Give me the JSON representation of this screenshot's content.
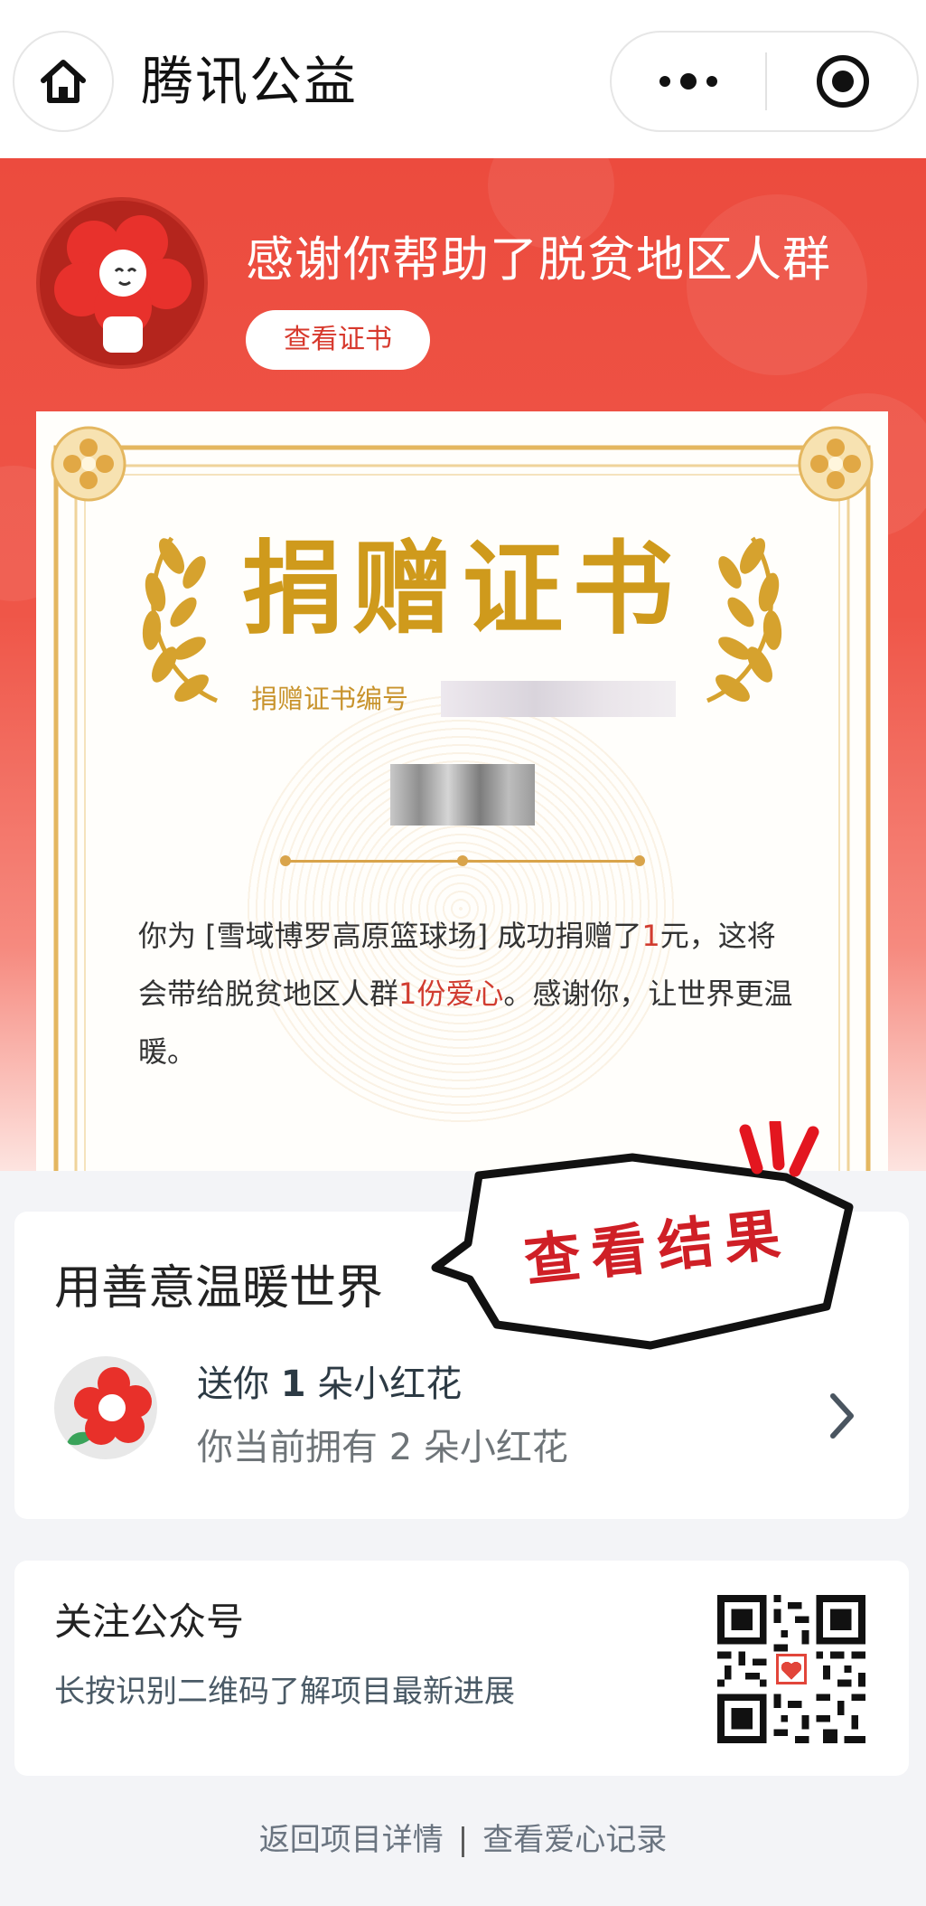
{
  "nav": {
    "title": "腾讯公益",
    "home_icon": "home-icon",
    "more_icon": "more-dots-icon",
    "close_icon": "target-close-icon"
  },
  "banner": {
    "title": "感谢你帮助了脱贫地区人群",
    "cert_button": "查看证书",
    "accent_color": "#ec4b3e"
  },
  "certificate": {
    "title": "捐赠证书",
    "number_label": "捐赠证书编号",
    "text_before": "你为 [雪域博罗高原篮球场] 成功捐赠了",
    "amount": "1",
    "text_mid1": "元，这将会带给脱贫地区人群",
    "love_count": "1份爱心",
    "text_end": "。感谢你，让世界更温暖。",
    "gold_color": "#cf9a1c"
  },
  "sticker": {
    "label": "查看结果"
  },
  "kindness_card": {
    "title": "用善意温暖世界",
    "gift_prefix": "送你",
    "gift_count": "1",
    "gift_suffix": "朵小红花",
    "owned_text": "你当前拥有 2 朵小红花"
  },
  "follow_card": {
    "title": "关注公众号",
    "subtitle": "长按识别二维码了解项目最新进展"
  },
  "footer": {
    "back_link": "返回项目详情",
    "separator": "|",
    "records_link": "查看爱心记录"
  }
}
